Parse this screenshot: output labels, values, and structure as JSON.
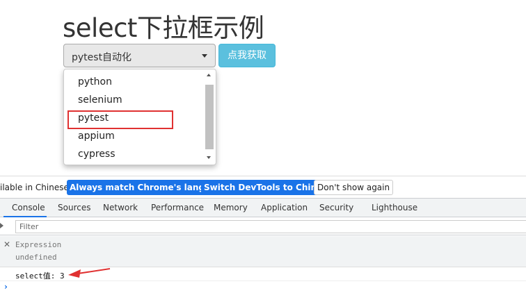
{
  "page": {
    "title": "select下拉框示例",
    "select_value": "pytest自动化",
    "fetch_button": "点我获取",
    "options": [
      "python",
      "selenium",
      "pytest",
      "appium",
      "cypress"
    ]
  },
  "language_bar": {
    "text": "ilable in Chinese!",
    "always_match": "Always match Chrome's language",
    "switch_chinese": "Switch DevTools to Chinese",
    "dont_show": "Don't show again"
  },
  "tabs": [
    "Console",
    "Sources",
    "Network",
    "Performance",
    "Memory",
    "Application",
    "Security",
    "Lighthouse"
  ],
  "console": {
    "filter_placeholder": "Filter",
    "expression_label": "Expression",
    "expression_value": "undefined",
    "log_line": "select值: 3",
    "prompt": "›"
  },
  "colors": {
    "info_button": "#5bc0de",
    "devtools_blue": "#1a73e8",
    "highlight_red": "#e03131"
  }
}
